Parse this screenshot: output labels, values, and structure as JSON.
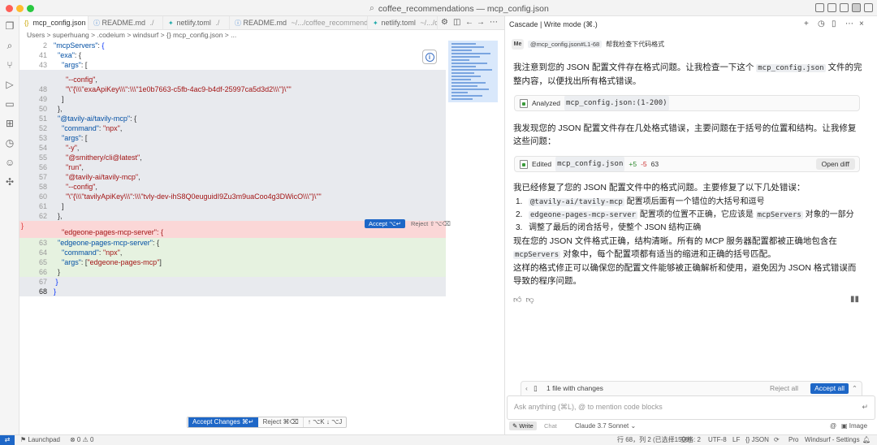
{
  "window": {
    "title": "coffee_recommendations — mcp_config.json"
  },
  "colors": {
    "accent": "#1e67c7",
    "deleted_bg": "#fbd7d7",
    "added_bg": "#e6f2e0"
  },
  "tabs": [
    {
      "label": "mcp_config.json",
      "desc": "",
      "active": true
    },
    {
      "label": "README.md",
      "desc": "./",
      "active": false
    },
    {
      "label": "netlify.toml",
      "desc": "./",
      "active": false
    },
    {
      "label": "README.md",
      "desc": "~/.../coffee_recommendations",
      "active": false
    },
    {
      "label": "netlify.toml",
      "desc": "~/.../coff",
      "active": false
    }
  ],
  "breadcrumb": "Users > superhuang > .codeium > windsurf > {} mcp_config.json > ...",
  "editor": {
    "inline_accept": "Accept ⌥↵",
    "inline_reject": "Reject ⇧⌥⌫"
  },
  "changes_bar": {
    "accept": "Accept Changes ⌘↵",
    "reject": "Reject ⌘⌫",
    "nav": "↑ ⌥K  ↓ ⌥J"
  },
  "status": {
    "remote": "⇄",
    "launchpad": "Launchpad",
    "problems": "⊗ 0  ⚠ 0",
    "position": "行 68，列 2 (已选择1508)",
    "spaces": "空格: 2",
    "encoding": "UTF-8",
    "eol": "LF",
    "language": "{} JSON",
    "plan": "Pro",
    "settings": "Windsurf - Settings"
  },
  "panel": {
    "title": "Cascade | Write mode (⌘.)",
    "avatar": "Me",
    "context_chip": "@mcp_config.json#L1-68",
    "user_message": "帮我检查下代码格式",
    "p1_a": "我注意到您的 JSON 配置文件存在格式问题。让我检查一下这个",
    "p1_code": "mcp_config.json",
    "p1_b": "文件的完整内容，以便找出所有格式错误。",
    "analyzed_label": "Analyzed",
    "analyzed_file": "mcp_config.json:(1-200)",
    "p2": "我发现您的 JSON 配置文件存在几处格式错误，主要问题在于括号的位置和结构。让我修复这些问题：",
    "edited_label": "Edited",
    "edited_file": "mcp_config.json",
    "edited_plus": "+5",
    "edited_minus": "-5",
    "edited_count": "63",
    "open_diff": "Open diff",
    "p3": "我已经修复了您的 JSON 配置文件中的格式问题。主要修复了以下几处错误：",
    "fixes": [
      {
        "num": "1.",
        "code": "@tavily-ai/tavily-mcp",
        "text": "配置项后面有一个错位的大括号和逗号",
        "code2": "",
        "text2": ""
      },
      {
        "num": "2.",
        "code": "edgeone-pages-mcp-server",
        "text": "配置项的位置不正确，它应该是",
        "code2": "mcpServers",
        "text2": "对象的一部分"
      },
      {
        "num": "3.",
        "code": "",
        "text": "调整了最后的闭合括号，使整个 JSON 结构正确",
        "code2": "",
        "text2": ""
      }
    ],
    "p4_a": "现在您的 JSON 文件格式正确，结构清晰。所有的 MCP 服务器配置都被正确地包含在",
    "p4_code": "mcpServers",
    "p4_b": "对象中，每个配置项都有适当的缩进和正确的括号匹配。",
    "p5": "这样的格式修正可以确保您的配置文件能够被正确解析和使用，避免因为 JSON 格式错误而导致的程序问题。",
    "file_changes": "1 file with changes",
    "reject_all": "Reject all",
    "accept_all": "Accept all",
    "input_placeholder": "Ask anything (⌘L), @ to mention code blocks",
    "mode_write": "Write",
    "mode_chat": "Chat",
    "model": "Claude 3.7 Sonnet",
    "image_label": "Image"
  }
}
